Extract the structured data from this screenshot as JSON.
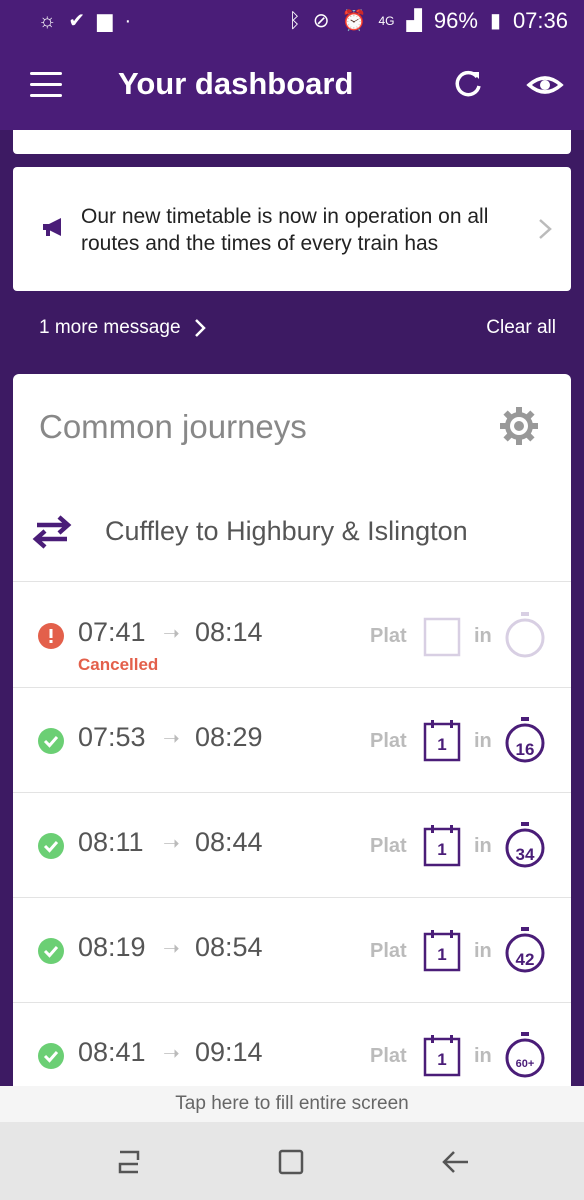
{
  "status_bar": {
    "battery": "96%",
    "time": "07:36",
    "network": "4G"
  },
  "app_bar": {
    "title": "Your dashboard"
  },
  "message": {
    "text": "Our new timetable is now in operation on all routes and the times of every train has",
    "more_label": "1 more message",
    "clear_label": "Clear all"
  },
  "journeys": {
    "title": "Common journeys",
    "route": "Cuffley to Highbury & Islington",
    "trains": [
      {
        "status": "cancelled",
        "dep": "07:41",
        "arr": "08:14",
        "note": "Cancelled",
        "plat_label": "Plat",
        "platform": "",
        "in_label": "in",
        "minutes": ""
      },
      {
        "status": "ok",
        "dep": "07:53",
        "arr": "08:29",
        "note": "",
        "plat_label": "Plat",
        "platform": "1",
        "in_label": "in",
        "minutes": "16"
      },
      {
        "status": "ok",
        "dep": "08:11",
        "arr": "08:44",
        "note": "",
        "plat_label": "Plat",
        "platform": "1",
        "in_label": "in",
        "minutes": "34"
      },
      {
        "status": "ok",
        "dep": "08:19",
        "arr": "08:54",
        "note": "",
        "plat_label": "Plat",
        "platform": "1",
        "in_label": "in",
        "minutes": "42"
      },
      {
        "status": "ok",
        "dep": "08:41",
        "arr": "09:14",
        "note": "",
        "plat_label": "Plat",
        "platform": "1",
        "in_label": "in",
        "minutes": "60+"
      }
    ]
  },
  "fill_screen": "Tap here to fill entire screen",
  "colors": {
    "brand_purple": "#4a1d78",
    "ok_green": "#6bcf74",
    "cancel_red": "#e3604b"
  }
}
